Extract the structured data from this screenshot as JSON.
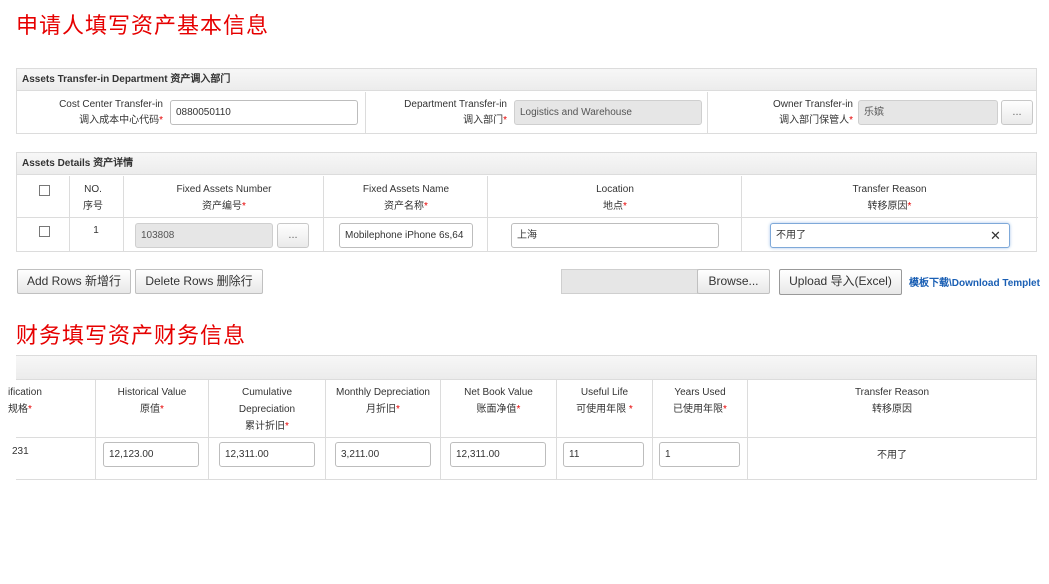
{
  "section1_title": "申请人填写资产基本信息",
  "section2_title": "财务填写资产财务信息",
  "dept_panel": {
    "title": "Assets Transfer-in Department 资产调入部门",
    "cost_center": {
      "label_en": "Cost Center Transfer-in",
      "label_cn": "调入成本中心代码",
      "value": "0880050110"
    },
    "department": {
      "label_en": "Department Transfer-in",
      "label_cn": "调入部门",
      "value": "Logistics and Warehouse"
    },
    "owner": {
      "label_en": "Owner Transfer-in",
      "label_cn": "调入部门保管人",
      "value": "乐嫔",
      "btn": "..."
    }
  },
  "details_panel": {
    "title": "Assets Details 资产详情",
    "headers": {
      "no_en": "NO.",
      "no_cn": "序号",
      "fan_en": "Fixed Assets Number",
      "fan_cn": "资产编号",
      "name_en": "Fixed Assets Name",
      "name_cn": "资产名称",
      "loc_en": "Location",
      "loc_cn": "地点",
      "reason_en": "Transfer Reason",
      "reason_cn": "转移原因"
    },
    "row": {
      "no": "1",
      "asset_number": "103808",
      "asset_btn": "...",
      "asset_name": "Mobilephone  iPhone 6s,64",
      "location": "上海",
      "reason": "不用了",
      "clear": "✕"
    }
  },
  "actions": {
    "add_rows": "Add Rows 新增行",
    "delete_rows": "Delete Rows 删除行",
    "browse": "Browse...",
    "upload": "Upload 导入(Excel)",
    "template_link": "模板下载\\Download Templet"
  },
  "finance_panel": {
    "headers": {
      "spec_en": "ification",
      "spec_cn": "规格",
      "hist_en": "Historical Value",
      "hist_cn": "原值",
      "cum_en1": "Cumulative",
      "cum_en2": "Depreciation",
      "cum_cn": "累计折旧",
      "mon_en": "Monthly Depreciation",
      "mon_cn": "月折旧",
      "nbv_en": "Net Book Value",
      "nbv_cn": "账面净值",
      "life_en": "Useful Life",
      "life_cn": "可使用年限",
      "used_en": "Years Used",
      "used_cn": "已使用年限",
      "reason_en": "Transfer Reason",
      "reason_cn": "转移原因"
    },
    "row": {
      "spec": "231",
      "historical_value": "12,123.00",
      "cumulative_depreciation": "12,311.00",
      "monthly_depreciation": "3,211.00",
      "net_book_value": "12,311.00",
      "useful_life": "11",
      "years_used": "1",
      "reason": "不用了"
    }
  },
  "colors": {
    "title_red": "#e60000",
    "link_blue": "#1a5fb4",
    "required": "#e60000"
  }
}
